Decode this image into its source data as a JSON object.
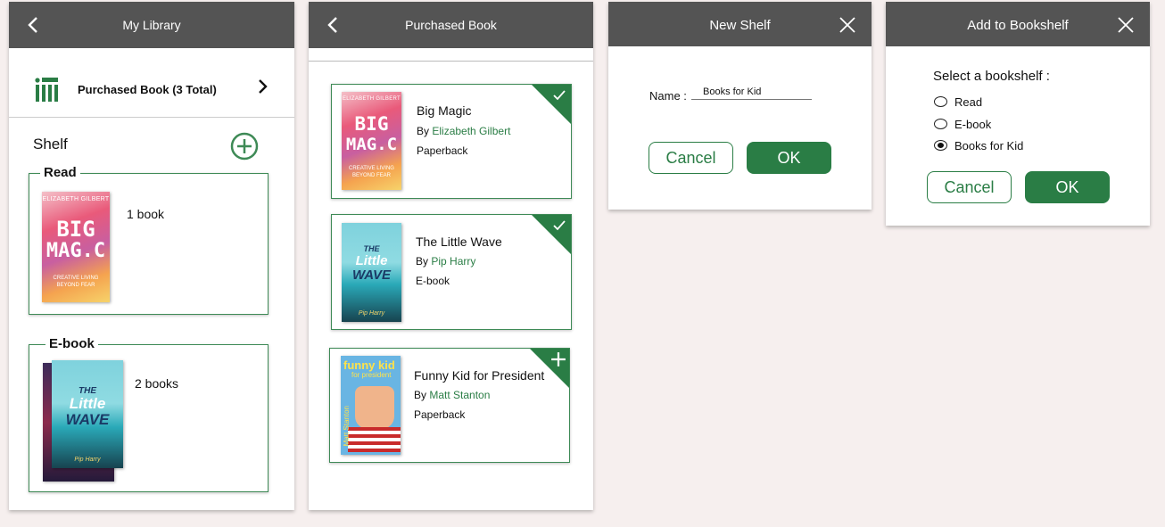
{
  "colors": {
    "accent": "#2a7d45",
    "header": "#545454",
    "background": "#f6efee"
  },
  "library": {
    "title": "My Library",
    "purchased_label": "Purchased Book  (3 Total)",
    "shelf_title": "Shelf",
    "shelves": [
      {
        "name": "Read",
        "count": "1 book"
      },
      {
        "name": "E-book",
        "count": "2 books"
      }
    ]
  },
  "purchased": {
    "title": "Purchased Book",
    "books": [
      {
        "title": "Big Magic",
        "by": "By",
        "author": "Elizabeth Gilbert",
        "format": "Paperback",
        "status_icon": "check-icon"
      },
      {
        "title": "The Little Wave",
        "by": "By",
        "author": "Pip Harry",
        "format": "E-book",
        "status_icon": "check-icon"
      },
      {
        "title": "Funny Kid for President",
        "by": "By",
        "author": "Matt Stanton",
        "format": "Paperback",
        "status_icon": "plus-icon"
      }
    ]
  },
  "covers": {
    "magic_author": "ELIZABETH GILBERT",
    "magic_line1": "BIG",
    "magic_line2": "MAG.C",
    "magic_sub": "CREATIVE LIVING BEYOND FEAR",
    "wave_line1": "THE",
    "wave_line2": "Little",
    "wave_line3": "WAVE",
    "wave_author": "Pip Harry",
    "funny_line1": "funny kid",
    "funny_line2": "for president",
    "funny_author": "Matt Stanton"
  },
  "new_shelf": {
    "title": "New Shelf",
    "name_label": "Name :",
    "name_value": "Books for Kid",
    "cancel": "Cancel",
    "ok": "OK"
  },
  "add_to_shelf": {
    "title": "Add to Bookshelf",
    "prompt": "Select a bookshelf :",
    "options": [
      {
        "label": "Read",
        "selected": false
      },
      {
        "label": "E-book",
        "selected": false
      },
      {
        "label": "Books for Kid",
        "selected": true
      }
    ],
    "cancel": "Cancel",
    "ok": "OK"
  }
}
